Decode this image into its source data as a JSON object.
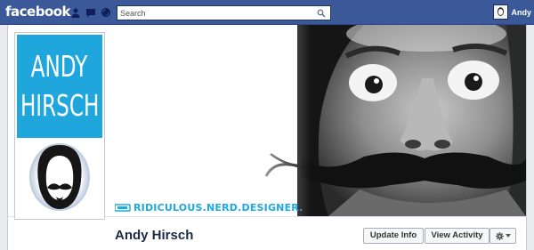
{
  "topbar": {
    "logo": "facebook",
    "jewels": [
      "friend-requests-icon",
      "messages-icon",
      "notifications-icon"
    ],
    "search_placeholder": "Search",
    "user_name": "Andy",
    "color": "#3b5998"
  },
  "cover": {
    "tagline": "RIDICULOUS.NERD.DESIGNER."
  },
  "profile": {
    "pic_first": "ANDY",
    "pic_last": "HIRSCH",
    "name": "Andy Hirsch",
    "accent": "#1ea6dd"
  },
  "actions": {
    "update_info": "Update Info",
    "view_activity": "View Activity",
    "settings_icon": "gear-icon"
  }
}
